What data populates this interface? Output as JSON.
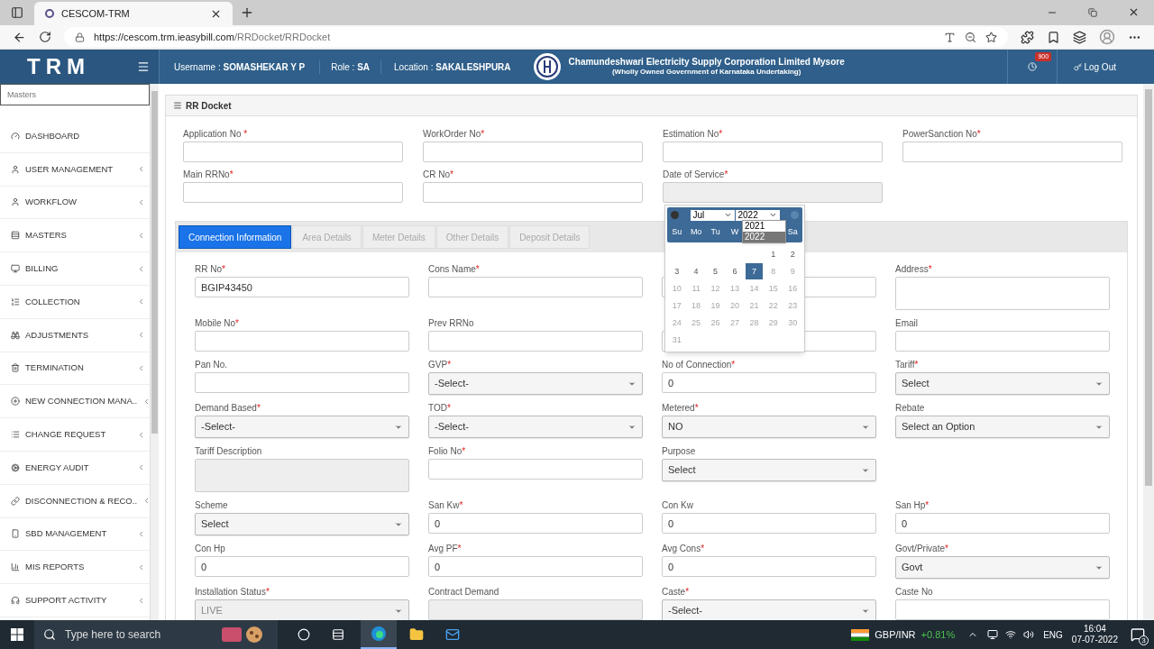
{
  "browser": {
    "tab_title": "CESCOM-TRM",
    "url_host": "https://cescom.trm.ieasybill.com",
    "url_path": "/RRDocket/RRDocket"
  },
  "header": {
    "logo": "TRM",
    "username_label": "Username : ",
    "username": "SOMASHEKAR Y P",
    "role_label": "Role : ",
    "role": "SA",
    "location_label": "Location : ",
    "location": "SAKALESHPURA",
    "org_title": "Chamundeshwari Electricity Supply Corporation Limited Mysore",
    "org_subtitle": "(Wholly Owned Government of Karnataka Undertaking)",
    "notification_count": "900",
    "logout": "Log Out"
  },
  "sidebar": {
    "search_placeholder": "Masters",
    "items": [
      {
        "label": "DASHBOARD",
        "expandable": false
      },
      {
        "label": "USER MANAGEMENT",
        "expandable": true
      },
      {
        "label": "WORKFLOW",
        "expandable": true
      },
      {
        "label": "MASTERS",
        "expandable": true
      },
      {
        "label": "BILLING",
        "expandable": true
      },
      {
        "label": "COLLECTION",
        "expandable": true
      },
      {
        "label": "ADJUSTMENTS",
        "expandable": true
      },
      {
        "label": "TERMINATION",
        "expandable": true
      },
      {
        "label": "NEW CONNECTION MANA..",
        "expandable": true
      },
      {
        "label": "CHANGE REQUEST",
        "expandable": true
      },
      {
        "label": "ENERGY AUDIT",
        "expandable": true
      },
      {
        "label": "DISCONNECTION & RECO..",
        "expandable": true
      },
      {
        "label": "SBD MANAGEMENT",
        "expandable": true
      },
      {
        "label": "MIS REPORTS",
        "expandable": true
      },
      {
        "label": "SUPPORT ACTIVITY",
        "expandable": true
      }
    ]
  },
  "panel": {
    "title": "RR Docket",
    "top_fields": [
      {
        "label": "Application No ",
        "mark": "*",
        "kind": "input"
      },
      {
        "label": "WorkOrder No",
        "mark": "*",
        "kind": "input"
      },
      {
        "label": "Estimation No",
        "mark": "*",
        "kind": "input"
      },
      {
        "label": "PowerSanction No",
        "mark": "*",
        "kind": "input"
      },
      {
        "label": "Main RRNo",
        "mark": "*",
        "kind": "input"
      },
      {
        "label": "CR No",
        "mark": "*",
        "kind": "input"
      },
      {
        "label": "Date of Service",
        "mark": "*",
        "kind": "readonly"
      }
    ],
    "tabs": [
      {
        "label": "Connection Information",
        "selected": true
      },
      {
        "label": "Area Details",
        "selected": false
      },
      {
        "label": "Meter Details",
        "selected": false
      },
      {
        "label": "Other Details",
        "selected": false
      },
      {
        "label": "Deposit Details",
        "selected": false
      }
    ],
    "fields": [
      {
        "label": "RR No",
        "mark": "*",
        "kind": "input",
        "value": "BGIP43450"
      },
      {
        "label": "Cons Name",
        "mark": "*",
        "kind": "input"
      },
      {
        "kind": "input"
      },
      {
        "label": "Address",
        "mark": "*",
        "kind": "textarea"
      },
      {
        "label": "Mobile No",
        "mark": "*",
        "kind": "input"
      },
      {
        "label": "Prev RRNo",
        "kind": "input"
      },
      {
        "kind": "input"
      },
      {
        "label": "Email",
        "kind": "input"
      },
      {
        "label": "Pan No.",
        "kind": "input"
      },
      {
        "label": "GVP",
        "mark": "*",
        "kind": "select",
        "value": "-Select-"
      },
      {
        "label": "No of Connection",
        "mark": "*",
        "kind": "input",
        "value": "0"
      },
      {
        "label": "Tariff",
        "mark": "*",
        "kind": "select",
        "value": "Select"
      },
      {
        "label": "Demand Based",
        "mark": "*",
        "kind": "select",
        "value": "-Select-"
      },
      {
        "label": "TOD",
        "mark": "*",
        "kind": "select",
        "value": "-Select-"
      },
      {
        "label": "Metered",
        "mark": "*",
        "kind": "select",
        "value": "NO"
      },
      {
        "label": "Rebate",
        "kind": "select",
        "value": "Select an Option"
      },
      {
        "label": "Tariff Description",
        "kind": "readonly_area"
      },
      {
        "label": "Folio No",
        "mark": "*",
        "kind": "input"
      },
      {
        "label": "Purpose",
        "kind": "select",
        "value": "Select"
      },
      {
        "kind": "none"
      },
      {
        "label": "Scheme",
        "kind": "select",
        "value": "Select"
      },
      {
        "label": "San Kw",
        "mark": "*",
        "kind": "input",
        "value": "0"
      },
      {
        "label": "Con Kw",
        "kind": "input",
        "value": "0"
      },
      {
        "label": "San Hp",
        "mark": "*",
        "kind": "input",
        "value": "0"
      },
      {
        "label": "Con Hp",
        "kind": "input",
        "value": "0"
      },
      {
        "label": "Avg PF",
        "mark": "*",
        "kind": "input",
        "value": "0"
      },
      {
        "label": "Avg Cons",
        "mark": "*",
        "kind": "input",
        "value": "0"
      },
      {
        "label": "Govt/Private",
        "mark": "*",
        "kind": "select",
        "value": "Govt"
      },
      {
        "label": "Installation Status",
        "mark": "*",
        "kind": "select",
        "value": "LIVE",
        "disabled": true
      },
      {
        "label": "Contract Demand",
        "kind": "readonly"
      },
      {
        "label": "Caste",
        "mark": "*",
        "kind": "select",
        "value": "-Select-"
      },
      {
        "label": "Caste No",
        "kind": "input"
      }
    ]
  },
  "calendar": {
    "month": "Jul",
    "year": "2022",
    "year_options": [
      {
        "label": "2021",
        "selected": false
      },
      {
        "label": "2022",
        "selected": true
      }
    ],
    "weekdays": [
      "Su",
      "Mo",
      "Tu",
      "W",
      "Sa"
    ],
    "weeks": [
      [
        {
          "label": "1",
          "disabled": false,
          "selected": false
        },
        {
          "label": "2",
          "disabled": false,
          "selected": false
        }
      ],
      [
        {
          "label": "3",
          "disabled": false,
          "selected": false
        },
        {
          "label": "4",
          "disabled": false,
          "selected": false
        },
        {
          "label": "5",
          "disabled": false,
          "selected": false
        },
        {
          "label": "6",
          "disabled": false,
          "selected": false
        },
        {
          "label": "7",
          "disabled": false,
          "selected": true
        },
        {
          "label": "8",
          "disabled": true,
          "selected": false
        },
        {
          "label": "9",
          "disabled": true,
          "selected": false
        }
      ],
      [
        {
          "label": "10",
          "disabled": true,
          "selected": false
        },
        {
          "label": "11",
          "disabled": true,
          "selected": false
        },
        {
          "label": "12",
          "disabled": true,
          "selected": false
        },
        {
          "label": "13",
          "disabled": true,
          "selected": false
        },
        {
          "label": "14",
          "disabled": true,
          "selected": false
        },
        {
          "label": "15",
          "disabled": true,
          "selected": false
        },
        {
          "label": "16",
          "disabled": true,
          "selected": false
        }
      ],
      [
        {
          "label": "17",
          "disabled": true,
          "selected": false
        },
        {
          "label": "18",
          "disabled": true,
          "selected": false
        },
        {
          "label": "19",
          "disabled": true,
          "selected": false
        },
        {
          "label": "20",
          "disabled": true,
          "selected": false
        },
        {
          "label": "21",
          "disabled": true,
          "selected": false
        },
        {
          "label": "22",
          "disabled": true,
          "selected": false
        },
        {
          "label": "23",
          "disabled": true,
          "selected": false
        }
      ],
      [
        {
          "label": "24",
          "disabled": true,
          "selected": false
        },
        {
          "label": "25",
          "disabled": true,
          "selected": false
        },
        {
          "label": "26",
          "disabled": true,
          "selected": false
        },
        {
          "label": "27",
          "disabled": true,
          "selected": false
        },
        {
          "label": "28",
          "disabled": true,
          "selected": false
        },
        {
          "label": "29",
          "disabled": true,
          "selected": false
        },
        {
          "label": "30",
          "disabled": true,
          "selected": false
        }
      ],
      [
        {
          "label": "31",
          "disabled": true,
          "selected": false
        }
      ]
    ]
  },
  "taskbar": {
    "search_placeholder": "Type here to search",
    "ticker": "GBP/INR",
    "change": "+0.81%",
    "language": "ENG",
    "time": "16:04",
    "date": "07-07-2022",
    "notifications": "3"
  }
}
